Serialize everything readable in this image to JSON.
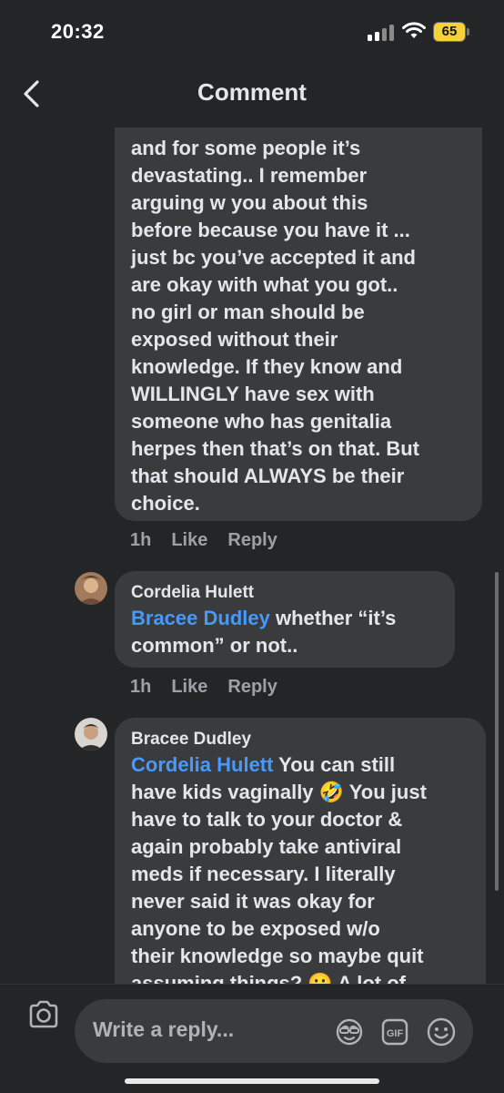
{
  "status": {
    "time": "20:32",
    "battery": "65"
  },
  "nav": {
    "title": "Comment"
  },
  "comments": [
    {
      "text": "and for some people it’s devastating.. I remember arguing w you about this before because you have it ... just bc you’ve accepted it and are okay with what you got.. no girl or man should be exposed without their knowledge. If they know and WILLINGLY have sex with someone who has genitalia herpes then that’s on that. But that should ALWAYS be their choice.",
      "lines": [
        "and for some people it’s",
        "devastating.. I remember",
        "arguing w you about this",
        "before because you have it ...",
        "just bc you’ve accepted it and",
        "are okay with what you got..",
        "no girl or man should be",
        "exposed without their",
        "knowledge. If they know and",
        "WILLINGLY have sex with",
        "someone who has genitalia",
        "herpes then that’s on that. But",
        "that should ALWAYS be their",
        "choice."
      ],
      "time": "1h",
      "like": "Like",
      "reply": "Reply"
    },
    {
      "author": "Cordelia Hulett",
      "mention": "Bracee Dudley",
      "line1_rest": " whether “it’s",
      "line2": "common” or not..",
      "time": "1h",
      "like": "Like",
      "reply": "Reply"
    },
    {
      "author": "Bracee Dudley",
      "mention": "Cordelia Hulett",
      "line1_rest": " You can still",
      "line2": "have kids vaginally 🤣 You just",
      "line3": "have to talk to your doctor &",
      "line4": "again probably take antiviral",
      "line5": "meds if necessary. I literally",
      "line6": "never said it was okay for",
      "line7": "anyone to be exposed w/o",
      "line8": "their knowledge so maybe quit",
      "line9": "assuming things? 😬 A lot of"
    }
  ],
  "reply_bar": {
    "placeholder": "Write a reply..."
  },
  "icons": {
    "back": "chevron-left-icon",
    "camera": "camera-icon",
    "sticker": "sticker-icon",
    "gif": "gif-icon",
    "emoji": "emoji-icon"
  },
  "colors": {
    "background": "#242526",
    "bubble": "#3a3b3c",
    "mention": "#4599ff",
    "meta": "#9da1a6",
    "battery": "#f4d23a"
  }
}
